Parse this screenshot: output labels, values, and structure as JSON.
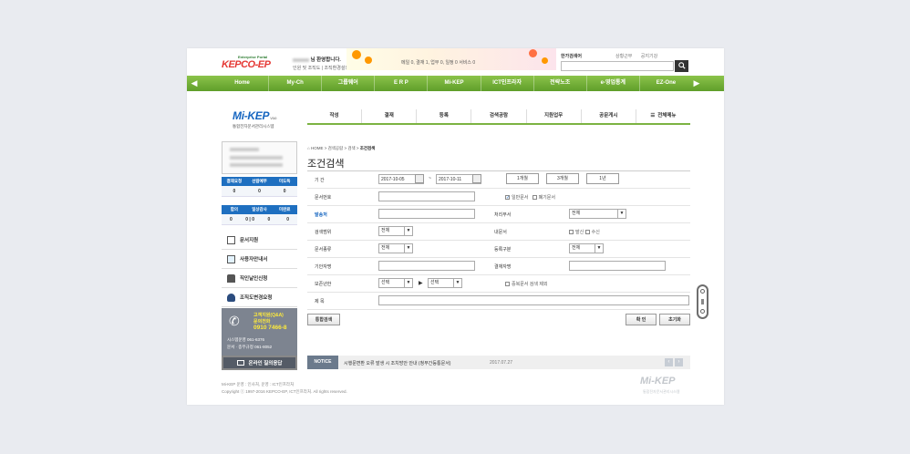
{
  "header": {
    "logo_sub": "Enterprise Portal",
    "logo_main": "KEPCO-EP",
    "welcome": "님 환영합니다.",
    "welcome_sub": "인원 및 조직도 | 조직환경설정",
    "banner_text": "메일 0, 결재 1, 업무 0, 일정 0 서비스 0",
    "search_label": "한가검색어",
    "toplinks": [
      "상황근무",
      "공지기강"
    ],
    "search_icon": "search-icon"
  },
  "gnav": {
    "items": [
      "Home",
      "My-Ch",
      "그룹웨어",
      "E R P",
      "Mi-KEP",
      "ICT인프라자",
      "전략노조",
      "e-영업통계",
      "EZ-One"
    ]
  },
  "left": {
    "brand": "Mi-KEP",
    "brand_ver": "V3.0",
    "brand_sub": "통합전자문서관리시스템",
    "stats1_head": [
      "결재요청",
      "선람예부",
      "미도독"
    ],
    "stats1_vals": [
      "0",
      "0",
      "0"
    ],
    "stats2_head": [
      "합의",
      "일상감사",
      "미완료"
    ],
    "stats2_vals": [
      "0",
      "0 | 0",
      "0",
      "0"
    ],
    "menu": [
      "문서지원",
      "사용자안내서",
      "직인날인신청",
      "조직도변경요청"
    ],
    "help": {
      "t1": "고객지원(Q&A)",
      "t2": "문의전화",
      "t3": "0910 7466-8",
      "t4": "시스템운영  061-6376",
      "t5": "문서 · 종무규정  061-8052"
    },
    "online_btn": "온라인 질의응답"
  },
  "subtabs": [
    "작성",
    "결재",
    "등록",
    "검색공람",
    "지원업무",
    "공문게시",
    "전체메뉴"
  ],
  "breadcrumb": {
    "home": "HOME",
    "path": [
      "검색공람",
      "검색"
    ],
    "current": "조건검색"
  },
  "page_title": "조건검색",
  "form": {
    "period_label": "기 간",
    "date_from": "2017-10-05",
    "date_to": "2017-10-11",
    "range_btns": [
      "1개월",
      "3개월",
      "1년"
    ],
    "docnum_label": "문서번호",
    "check_general": "일반문서",
    "check_discard": "폐기문서",
    "sender_label": "발송처",
    "handling_dept_label": "처리부서",
    "handling_dept_val": "전체",
    "scope_label": "검색범위",
    "scope_val": "전체",
    "internal_label": "내문서",
    "check_send": "발신",
    "check_receive": "수신",
    "doctype_label": "문서종류",
    "doctype_val": "전체",
    "regtype_label": "등록구분",
    "regtype_val": "전체",
    "drafter_label": "기안자명",
    "approver_label": "결재자명",
    "retention_label": "보존년한",
    "retention_from": "선택",
    "retention_to": "선택",
    "check_dup": "중복문서 검색 제외",
    "subject_label": "제 목",
    "advanced_btn": "통합검색",
    "ok_btn": "확 인",
    "reset_btn": "초기화"
  },
  "notice": {
    "tag": "NOTICE",
    "text": "시행문변환 오류 발생 시 조치방안 안내 (청부간등통문서)",
    "date": "2017.07.27"
  },
  "footer": {
    "line1": "Mi-KEP 운영 : 인사처, 운영 : ICT인프라처",
    "line2": "Copyright ⓒ 1997-2016 KEPCO-EP, ICT인프라처. All rights reserved.",
    "logo": "Mi-KEP",
    "logo_sub": "통합전자문서관리시스템"
  }
}
